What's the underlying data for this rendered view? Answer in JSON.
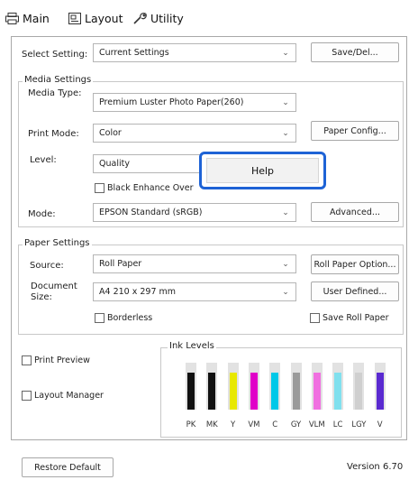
{
  "tabs": [
    {
      "label": "Main",
      "icon": "printer-icon"
    },
    {
      "label": "Layout",
      "icon": "layout-icon"
    },
    {
      "label": "Utility",
      "icon": "wrench-icon"
    }
  ],
  "select_setting": {
    "label": "Select Setting:",
    "value": "Current Settings",
    "save_button": "Save/Del..."
  },
  "media_settings": {
    "title": "Media Settings",
    "media_type_label": "Media Type:",
    "media_type_value": "Premium Luster Photo Paper(260)",
    "print_mode_label": "Print Mode:",
    "print_mode_value": "Color",
    "paper_config_button": "Paper Config...",
    "level_label": "Level:",
    "level_value": "Quality",
    "black_enhance_label": "Black Enhance Over",
    "mode_label": "Mode:",
    "mode_value": "EPSON Standard (sRGB)",
    "advanced_button": "Advanced..."
  },
  "context_menu": {
    "help_label": "Help"
  },
  "paper_settings": {
    "title": "Paper Settings",
    "source_label": "Source:",
    "source_value": "Roll Paper",
    "roll_paper_option_button": "Roll Paper Option...",
    "document_size_label_line1": "Document",
    "document_size_label_line2": "Size:",
    "document_size_value": "A4 210 x 297 mm",
    "user_defined_button": "User Defined...",
    "borderless_label": "Borderless",
    "save_roll_paper_label": "Save Roll Paper"
  },
  "print_preview_label": "Print Preview",
  "layout_manager_label": "Layout Manager",
  "ink_levels": {
    "title": "Ink Levels",
    "inks": [
      {
        "code": "PK",
        "color": "#111111",
        "level": 0.78
      },
      {
        "code": "MK",
        "color": "#111111",
        "level": 0.78
      },
      {
        "code": "Y",
        "color": "#e8e800",
        "level": 0.78
      },
      {
        "code": "VM",
        "color": "#e000c8",
        "level": 0.78
      },
      {
        "code": "C",
        "color": "#00c8e8",
        "level": 0.78
      },
      {
        "code": "GY",
        "color": "#9a9a9a",
        "level": 0.78
      },
      {
        "code": "VLM",
        "color": "#f070e0",
        "level": 0.78
      },
      {
        "code": "LC",
        "color": "#80e0ee",
        "level": 0.78
      },
      {
        "code": "LGY",
        "color": "#cfcfcf",
        "level": 0.78
      },
      {
        "code": "V",
        "color": "#5a2ad0",
        "level": 0.78
      }
    ]
  },
  "restore_default_button": "Restore Default",
  "version": "Version 6.70"
}
